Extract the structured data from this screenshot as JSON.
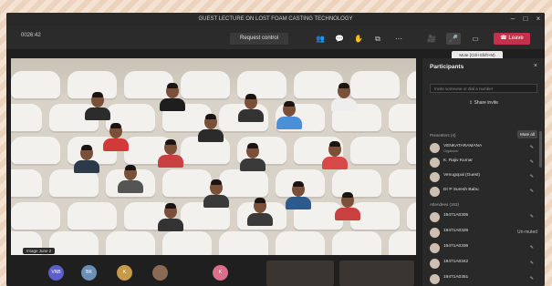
{
  "window": {
    "title": "GUEST LECTURE ON LOST FOAM CASTING TECHNOLOGY"
  },
  "toolbar": {
    "elapsed": "0026:42",
    "request_control": "Request control",
    "leave": "Leave",
    "mic_tooltip": "Mute (Ctrl+Shift+M)"
  },
  "stage": {
    "label": "Image June 2"
  },
  "participants": {
    "title": "Participants",
    "search_placeholder": "Invite someone or dial a number",
    "share_invite": "Share invite",
    "presenters_header": "Presenters (4)",
    "mute_all": "Mute all",
    "presenters": [
      {
        "name": "VENKATARAMANA",
        "sub": "Organizer"
      },
      {
        "name": "K. Rajiv Kumar",
        "sub": ""
      },
      {
        "name": "Venugopal (Guest)",
        "sub": ""
      },
      {
        "name": "Dr P Suresh Babu",
        "sub": ""
      }
    ],
    "attendees_header": "Attendees (163)",
    "attendees": [
      {
        "name": "19471A0305",
        "status": ""
      },
      {
        "name": "19471A0326",
        "status": "Un-muted"
      },
      {
        "name": "19471A0336",
        "status": ""
      },
      {
        "name": "19471A0342",
        "status": ""
      },
      {
        "name": "19471A0351",
        "status": ""
      }
    ]
  },
  "bottom_avatars": [
    "VNB",
    "BK",
    "K",
    "",
    "K"
  ],
  "colors": {
    "accent": "#c4314b",
    "panel_bg": "#292929",
    "bar_bg": "#2b2b2b"
  }
}
